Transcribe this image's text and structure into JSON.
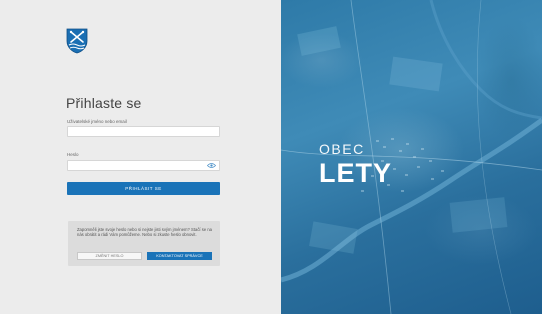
{
  "login": {
    "title": "Přihlaste se",
    "username_label": "Uživatelské jméno nebo email",
    "username_value": "",
    "password_label": "Heslo",
    "password_value": "",
    "submit_label": "Přihlásit se"
  },
  "help": {
    "text": "Zapomněli jste svoje heslo nebo si nejste jisti svým jménem? Stačí se na nás obrátit a rádi Vám pomůžeme. Nebo si zkuste heslo obnovit.",
    "reset_label": "Změnit heslo",
    "contact_label": "Kontaktovat správce"
  },
  "brand": {
    "line1": "OBEC",
    "line2": "LETY"
  },
  "icons": {
    "crest": "municipal-crest-icon",
    "eye": "show-password-eye-icon"
  },
  "colors": {
    "accent": "#1a73b8",
    "panel_bg": "#ececec",
    "aerial_tint": "#2e7aa8"
  }
}
